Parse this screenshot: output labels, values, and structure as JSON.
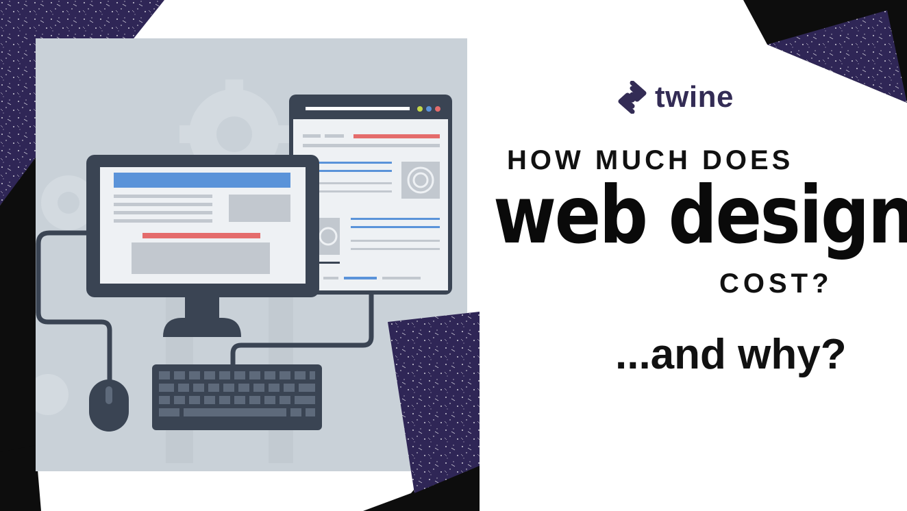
{
  "brand": {
    "name": "twine",
    "logo_icon": "twine-logo-icon",
    "text_color": "#332c55"
  },
  "headline": {
    "line1": "HOW MUCH DOES",
    "line2": "web design",
    "line3": "COST?",
    "line4": "...and why?"
  },
  "colors": {
    "accent_purple": "#2f2656",
    "black": "#0d0d0d",
    "panel_bg": "#c9d1d8",
    "monitor_frame": "#3a4453",
    "highlight_blue": "#5a93d9",
    "highlight_red": "#e46c6c"
  },
  "icons": [
    "monitor-icon",
    "browser-window-icon",
    "keyboard-icon",
    "mouse-icon",
    "gear-icon"
  ]
}
